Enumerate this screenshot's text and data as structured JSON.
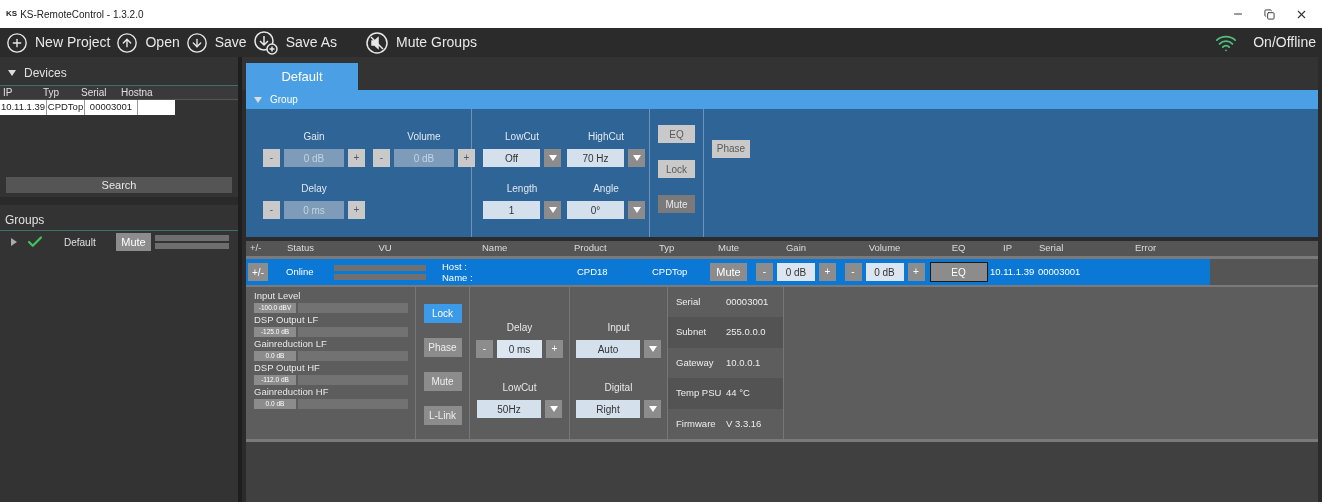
{
  "window": {
    "logo": "KS",
    "title": "KS-RemoteControl - 1.3.2.0"
  },
  "toolbar": {
    "items": [
      {
        "kind": "new",
        "label": "New Project"
      },
      {
        "kind": "open",
        "label": "Open"
      },
      {
        "kind": "save",
        "label": "Save"
      },
      {
        "kind": "saveas",
        "label": "Save As"
      },
      {
        "kind": "mute",
        "label": "Mute Groups"
      }
    ],
    "status": {
      "label": "On/Offline"
    }
  },
  "devices": {
    "title": "Devices",
    "expanded": true,
    "columns": [
      "IP",
      "Typ",
      "Serial",
      "Hostna"
    ],
    "rows": [
      [
        "10.11.1.39",
        "CPDTop",
        "00003001"
      ]
    ]
  },
  "search_button": "Search",
  "groups": {
    "title": "Groups",
    "items": [
      {
        "name": "Default",
        "expanded": false,
        "ok": true,
        "mute": "Mute"
      }
    ]
  },
  "tabs": [
    {
      "label": "Default",
      "selected": true
    }
  ],
  "group": {
    "title": "Group",
    "expanded": true,
    "steppers": [
      {
        "label": "Gain",
        "value": "0 dB",
        "minus": "-",
        "plus": "+"
      },
      {
        "label": "Volume",
        "value": "0 dB",
        "minus": "-",
        "plus": "+"
      },
      {
        "label": "Delay",
        "value": "0 ms",
        "minus": "-",
        "plus": "+"
      }
    ],
    "dropdowns": [
      {
        "label": "LowCut",
        "value": "Off"
      },
      {
        "label": "HighCut",
        "value": "70 Hz"
      },
      {
        "label": "Length",
        "value": "1"
      },
      {
        "label": "Angle",
        "value": "0°"
      }
    ],
    "buttons": [
      {
        "label": "EQ",
        "disabled": true
      },
      {
        "label": "Lock",
        "disabled": true
      },
      {
        "label": "Mute",
        "disabled": false
      }
    ],
    "extra_buttons": [
      {
        "label": "Phase",
        "disabled": true
      }
    ]
  },
  "table": {
    "columns": [
      "+/-",
      "Status",
      "VU",
      "Name",
      "Product",
      "Typ",
      "Mute",
      "Gain",
      "Volume",
      "EQ",
      "IP",
      "Serial",
      "Error"
    ],
    "rows": [
      {
        "selected": true,
        "toggle": "+/-",
        "status": "Online",
        "name_labels": [
          "Host :",
          "Name :"
        ],
        "product": "CPD18",
        "typ": "CPDTop",
        "mute": "Mute",
        "gain": {
          "value": "0 dB",
          "minus": "-",
          "plus": "+"
        },
        "volume": {
          "value": "0 dB",
          "minus": "-",
          "plus": "+"
        },
        "eq": "EQ",
        "ip": "10.11.1.39",
        "serial": "00003001"
      }
    ]
  },
  "detail": {
    "meters": [
      {
        "label": "Input Level",
        "reading": "-100.0 dBV"
      },
      {
        "label": "DSP Output LF",
        "reading": "-125.0 dB"
      },
      {
        "label": "Gainreduction LF",
        "reading": "0.0 dB"
      },
      {
        "label": "DSP Output HF",
        "reading": "-112.0 dB"
      },
      {
        "label": "Gainreduction HF",
        "reading": "0.0 dB"
      }
    ],
    "buttons": [
      {
        "label": "Lock",
        "on": true
      },
      {
        "label": "Phase",
        "on": false
      },
      {
        "label": "Mute",
        "on": false
      },
      {
        "label": "L-Link",
        "on": false
      }
    ],
    "delay": {
      "label": "Delay",
      "value": "0 ms",
      "minus": "-",
      "plus": "+"
    },
    "dropdowns": [
      {
        "label": "LowCut",
        "value": "50Hz"
      },
      {
        "label": "Input",
        "value": "Auto"
      },
      {
        "label": "Digital",
        "value": "Right"
      }
    ],
    "info": [
      {
        "label": "Serial",
        "value": "00003001"
      },
      {
        "label": "Subnet",
        "value": "255.0.0.0"
      },
      {
        "label": "Gateway",
        "value": "10.0.0.1"
      },
      {
        "label": "Temp PSU",
        "value": "44 °C"
      },
      {
        "label": "Firmware",
        "value": "V 3.3.16"
      }
    ]
  }
}
